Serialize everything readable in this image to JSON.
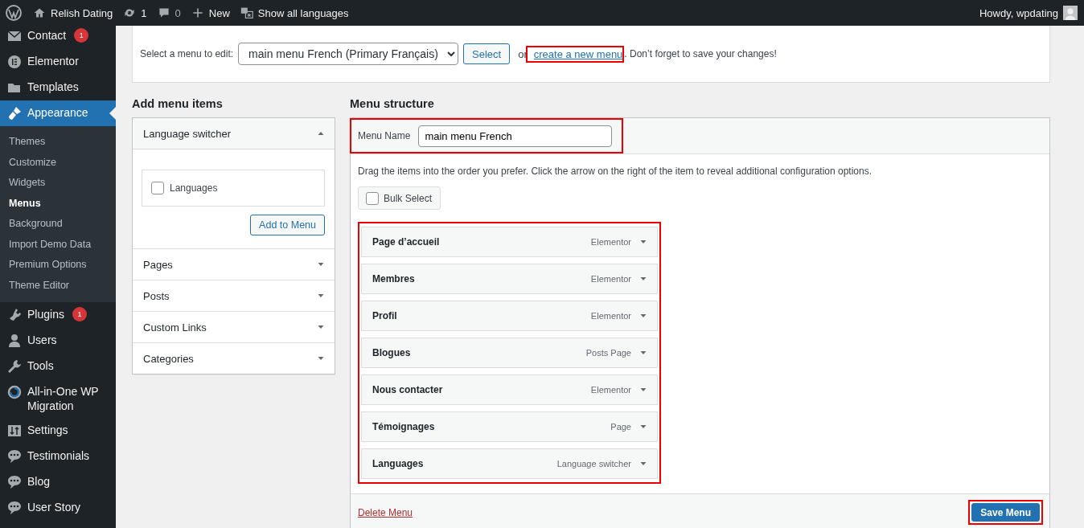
{
  "admin_bar": {
    "site": "Relish Dating",
    "updates": "1",
    "comments": "0",
    "new": "New",
    "languages": "Show all languages",
    "greeting": "Howdy, wpdating"
  },
  "sidebar": {
    "items": [
      {
        "label": "Contact",
        "badge": "1",
        "selected": false
      },
      {
        "label": "Elementor",
        "selected": false
      },
      {
        "label": "Templates",
        "selected": false
      },
      {
        "label": "Appearance",
        "selected": true,
        "children": [
          {
            "label": "Themes",
            "selected": false
          },
          {
            "label": "Customize",
            "selected": false
          },
          {
            "label": "Widgets",
            "selected": false
          },
          {
            "label": "Menus",
            "selected": true
          },
          {
            "label": "Background",
            "selected": false
          },
          {
            "label": "Import Demo Data",
            "selected": false
          },
          {
            "label": "Premium Options",
            "selected": false
          },
          {
            "label": "Theme Editor",
            "selected": false
          }
        ]
      },
      {
        "label": "Plugins",
        "badge": "1",
        "selected": false
      },
      {
        "label": "Users",
        "selected": false
      },
      {
        "label": "Tools",
        "selected": false
      },
      {
        "label": "All-in-One WP Migration",
        "selected": false
      },
      {
        "label": "Settings",
        "selected": false
      },
      {
        "label": "Testimonials",
        "selected": false
      },
      {
        "label": "Blog",
        "selected": false
      },
      {
        "label": "User Story",
        "selected": false
      }
    ]
  },
  "menu_select": {
    "label": "Select a menu to edit:",
    "value": "main menu French (Primary Français)",
    "button": "Select",
    "or": "or",
    "link": "create a new menu",
    "link_highlighted": true,
    "note": ". Don’t forget to save your changes!"
  },
  "add_items": {
    "title": "Add menu items",
    "sections": [
      {
        "title": "Language switcher",
        "expanded": true,
        "options": [
          {
            "label": "Languages",
            "checked": false
          }
        ],
        "button": "Add to Menu"
      },
      {
        "title": "Pages",
        "expanded": false
      },
      {
        "title": "Posts",
        "expanded": false
      },
      {
        "title": "Custom Links",
        "expanded": false
      },
      {
        "title": "Categories",
        "expanded": false
      }
    ]
  },
  "structure": {
    "title": "Menu structure",
    "name_label": "Menu Name",
    "name_value": "main menu French",
    "name_highlighted": true,
    "hint": "Drag the items into the order you prefer. Click the arrow on the right of the item to reveal additional configuration options.",
    "bulk_select": {
      "label": "Bulk Select",
      "checked": false
    },
    "items_highlighted": true,
    "items": [
      {
        "title": "Page d’accueil",
        "type": "Elementor"
      },
      {
        "title": "Membres",
        "type": "Elementor"
      },
      {
        "title": "Profil",
        "type": "Elementor"
      },
      {
        "title": "Blogues",
        "type": "Posts Page"
      },
      {
        "title": "Nous contacter",
        "type": "Elementor"
      },
      {
        "title": "Témoignages",
        "type": "Page"
      },
      {
        "title": "Languages",
        "type": "Language switcher"
      }
    ],
    "delete": "Delete Menu",
    "save": "Save Menu",
    "save_highlighted": true
  }
}
